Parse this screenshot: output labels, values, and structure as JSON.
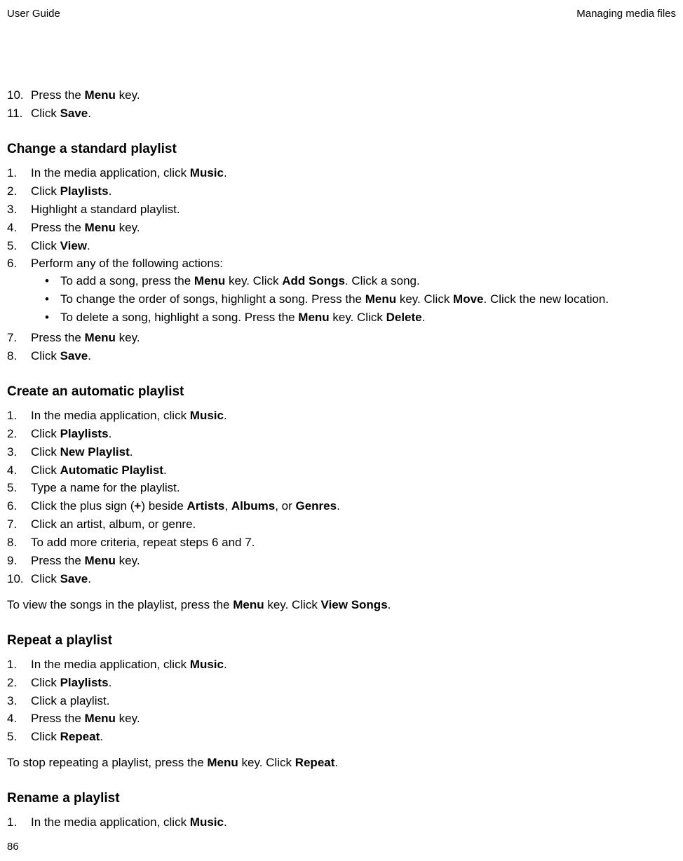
{
  "header": {
    "left": "User Guide",
    "right": "Managing media files"
  },
  "pageNumber": "86",
  "intro": {
    "items": [
      {
        "n": "10.",
        "pre": "Press the ",
        "b": "Menu",
        "post": " key."
      },
      {
        "n": "11.",
        "pre": "Click ",
        "b": "Save",
        "post": "."
      }
    ]
  },
  "sections": [
    {
      "title": "Change a standard playlist",
      "steps": [
        {
          "n": "1.",
          "parts": [
            {
              "t": "In the media application, click "
            },
            {
              "b": "Music"
            },
            {
              "t": "."
            }
          ]
        },
        {
          "n": "2.",
          "parts": [
            {
              "t": "Click "
            },
            {
              "b": "Playlists"
            },
            {
              "t": "."
            }
          ]
        },
        {
          "n": "3.",
          "parts": [
            {
              "t": "Highlight a standard playlist."
            }
          ]
        },
        {
          "n": "4.",
          "parts": [
            {
              "t": "Press the "
            },
            {
              "b": "Menu"
            },
            {
              "t": " key."
            }
          ]
        },
        {
          "n": "5.",
          "parts": [
            {
              "t": "Click "
            },
            {
              "b": "View"
            },
            {
              "t": "."
            }
          ]
        },
        {
          "n": "6.",
          "parts": [
            {
              "t": "Perform any of the following actions:"
            }
          ],
          "bullets": [
            {
              "parts": [
                {
                  "t": "To add a song, press the "
                },
                {
                  "b": "Menu"
                },
                {
                  "t": " key. Click "
                },
                {
                  "b": "Add Songs"
                },
                {
                  "t": ". Click a song."
                }
              ]
            },
            {
              "parts": [
                {
                  "t": "To change the order of songs, highlight a song. Press the "
                },
                {
                  "b": "Menu"
                },
                {
                  "t": " key. Click "
                },
                {
                  "b": "Move"
                },
                {
                  "t": ". Click the new location."
                }
              ]
            },
            {
              "parts": [
                {
                  "t": "To delete a song, highlight a song. Press the "
                },
                {
                  "b": "Menu"
                },
                {
                  "t": " key. Click "
                },
                {
                  "b": "Delete"
                },
                {
                  "t": "."
                }
              ]
            }
          ]
        },
        {
          "n": "7.",
          "parts": [
            {
              "t": "Press the "
            },
            {
              "b": "Menu"
            },
            {
              "t": " key."
            }
          ]
        },
        {
          "n": "8.",
          "parts": [
            {
              "t": "Click "
            },
            {
              "b": "Save"
            },
            {
              "t": "."
            }
          ]
        }
      ]
    },
    {
      "title": "Create an automatic playlist",
      "steps": [
        {
          "n": "1.",
          "parts": [
            {
              "t": "In the media application, click "
            },
            {
              "b": "Music"
            },
            {
              "t": "."
            }
          ]
        },
        {
          "n": "2.",
          "parts": [
            {
              "t": "Click "
            },
            {
              "b": "Playlists"
            },
            {
              "t": "."
            }
          ]
        },
        {
          "n": "3.",
          "parts": [
            {
              "t": "Click "
            },
            {
              "b": "New Playlist"
            },
            {
              "t": "."
            }
          ]
        },
        {
          "n": "4.",
          "parts": [
            {
              "t": "Click "
            },
            {
              "b": "Automatic Playlist"
            },
            {
              "t": "."
            }
          ]
        },
        {
          "n": "5.",
          "parts": [
            {
              "t": "Type a name for the playlist."
            }
          ]
        },
        {
          "n": "6.",
          "parts": [
            {
              "t": "Click the plus sign ("
            },
            {
              "b": "+"
            },
            {
              "t": ") beside "
            },
            {
              "b": "Artists"
            },
            {
              "t": ", "
            },
            {
              "b": "Albums"
            },
            {
              "t": ", or "
            },
            {
              "b": "Genres"
            },
            {
              "t": "."
            }
          ]
        },
        {
          "n": "7.",
          "parts": [
            {
              "t": "Click an artist, album, or genre."
            }
          ]
        },
        {
          "n": "8.",
          "parts": [
            {
              "t": "To add more criteria, repeat steps 6 and 7."
            }
          ]
        },
        {
          "n": "9.",
          "parts": [
            {
              "t": "Press the "
            },
            {
              "b": "Menu"
            },
            {
              "t": " key."
            }
          ]
        },
        {
          "n": "10.",
          "parts": [
            {
              "t": "Click "
            },
            {
              "b": "Save"
            },
            {
              "t": "."
            }
          ]
        }
      ],
      "after": [
        {
          "t": "To view the songs in the playlist, press the "
        },
        {
          "b": "Menu"
        },
        {
          "t": " key. Click "
        },
        {
          "b": "View Songs"
        },
        {
          "t": "."
        }
      ]
    },
    {
      "title": "Repeat a playlist",
      "steps": [
        {
          "n": "1.",
          "parts": [
            {
              "t": "In the media application, click "
            },
            {
              "b": "Music"
            },
            {
              "t": "."
            }
          ]
        },
        {
          "n": "2.",
          "parts": [
            {
              "t": "Click "
            },
            {
              "b": "Playlists"
            },
            {
              "t": "."
            }
          ]
        },
        {
          "n": "3.",
          "parts": [
            {
              "t": "Click a playlist."
            }
          ]
        },
        {
          "n": "4.",
          "parts": [
            {
              "t": "Press the "
            },
            {
              "b": "Menu"
            },
            {
              "t": " key."
            }
          ]
        },
        {
          "n": "5.",
          "parts": [
            {
              "t": "Click "
            },
            {
              "b": "Repeat"
            },
            {
              "t": "."
            }
          ]
        }
      ],
      "after": [
        {
          "t": "To stop repeating a playlist, press the "
        },
        {
          "b": "Menu"
        },
        {
          "t": " key. Click "
        },
        {
          "b": "Repeat"
        },
        {
          "t": "."
        }
      ]
    },
    {
      "title": "Rename a playlist",
      "steps": [
        {
          "n": "1.",
          "parts": [
            {
              "t": "In the media application, click "
            },
            {
              "b": "Music"
            },
            {
              "t": "."
            }
          ]
        }
      ]
    }
  ]
}
